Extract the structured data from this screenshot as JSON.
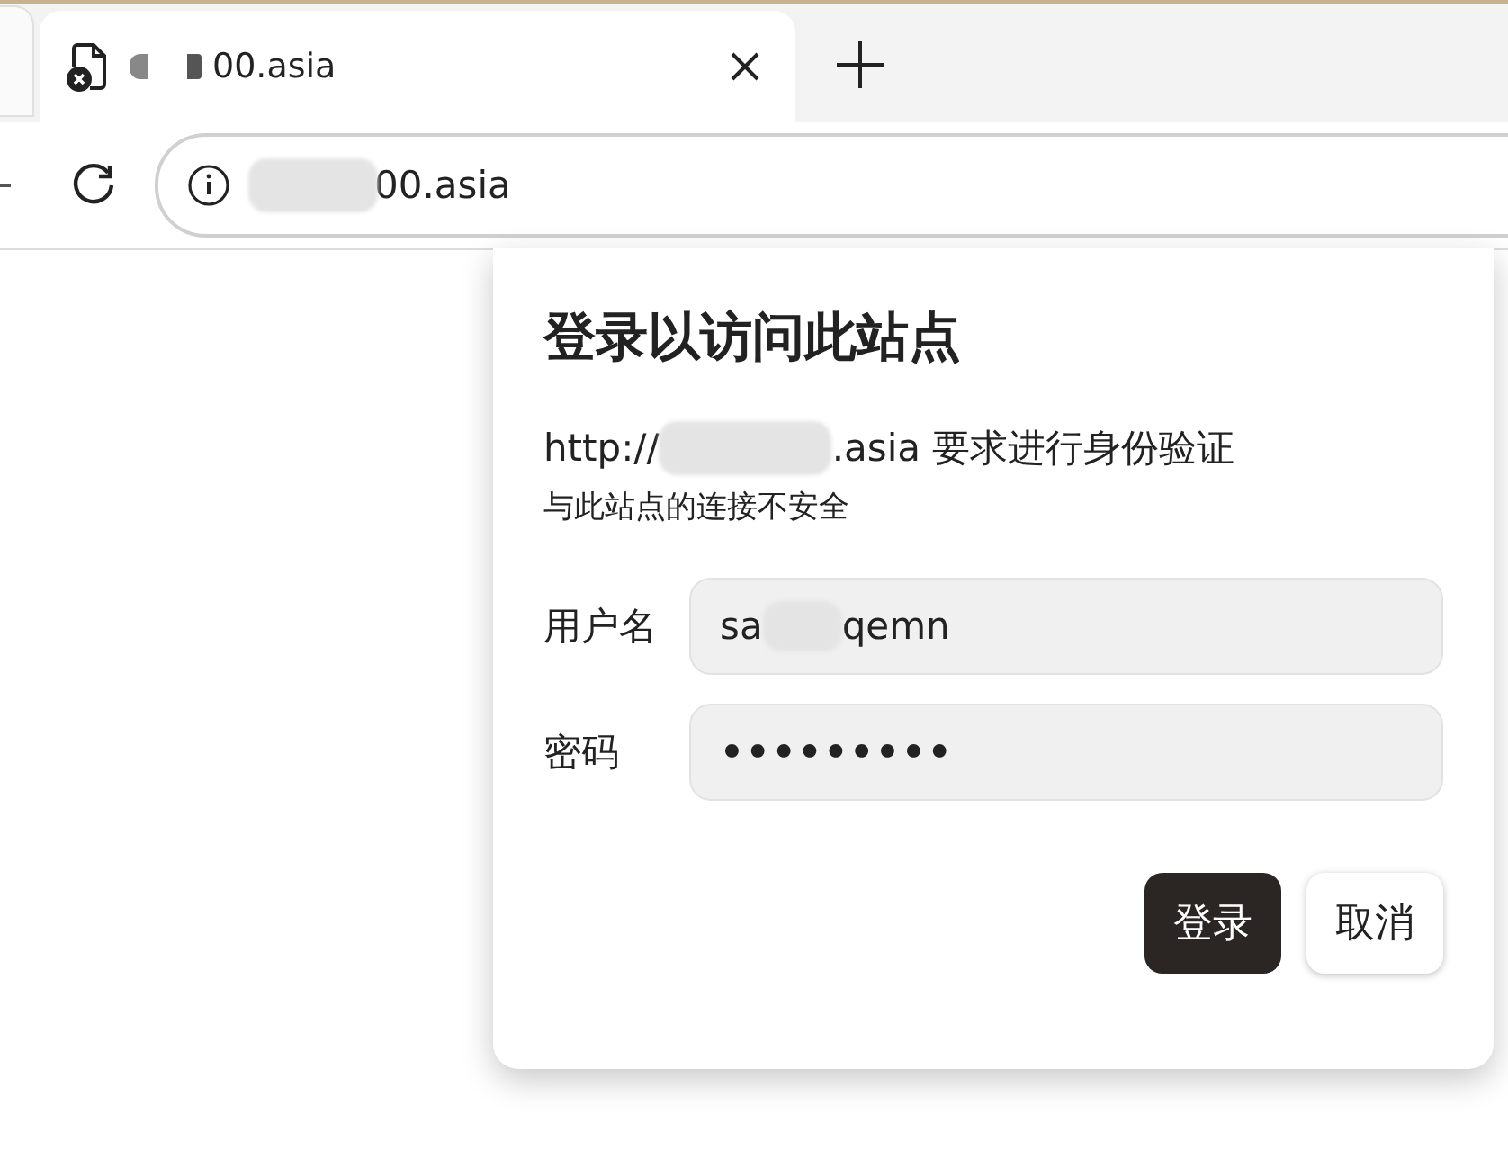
{
  "tab": {
    "title": "00.asia",
    "selected": true
  },
  "address_bar": {
    "url": "00.asia"
  },
  "dialog": {
    "title": "登录以访问此站点",
    "message": {
      "prefix": "http://",
      "suffix": ".asia 要求进行身份验证"
    },
    "warning": "与此站点的连接不安全",
    "fields": [
      {
        "kind": "text",
        "label": "用户名",
        "value_start": "sa",
        "value_end": "qemn"
      },
      {
        "kind": "password",
        "label": "密码",
        "value": "•••••••••"
      }
    ],
    "buttons": [
      {
        "label": "登录",
        "kind": "primary"
      },
      {
        "label": "取消",
        "kind": "secondary"
      }
    ]
  }
}
